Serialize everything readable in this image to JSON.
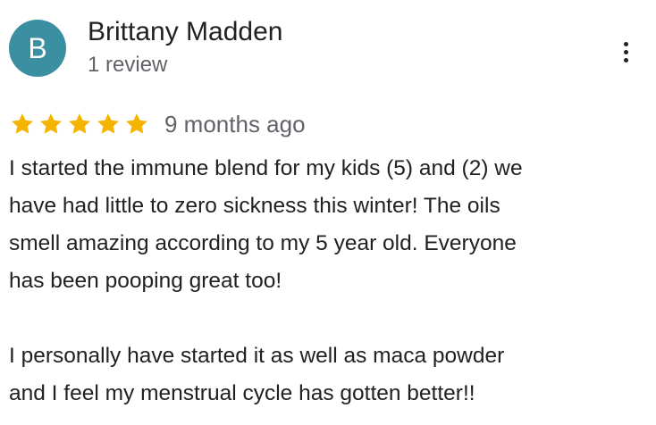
{
  "reviewer": {
    "initial": "B",
    "avatar_color": "#3a8fa0",
    "name": "Brittany Madden",
    "review_count": "1 review"
  },
  "menu": {
    "icon": "more-vert-icon"
  },
  "review": {
    "rating": 5,
    "max_rating": 5,
    "star_color": "#f4b400",
    "time_ago": "9 months ago",
    "text": "I started the immune blend for my kids (5) and (2) we\nhave had little to zero sickness this winter! The oils\nsmell amazing according to my 5 year old. Everyone\nhas been pooping great too!\n\nI personally have started it as well as maca powder\nand I feel my menstrual cycle has gotten better!!"
  }
}
